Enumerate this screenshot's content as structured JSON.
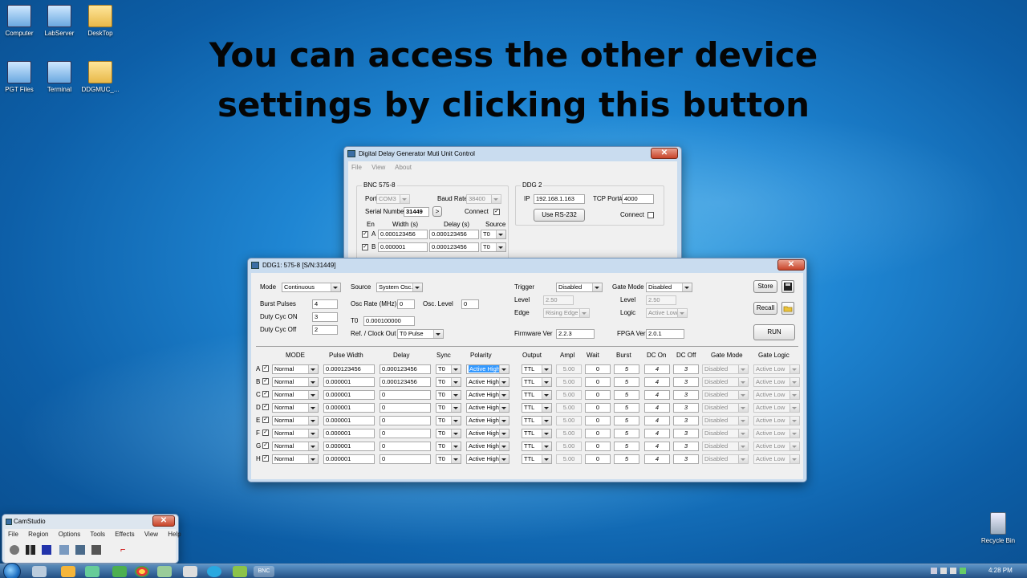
{
  "headline": {
    "line1": "You can access the other device",
    "line2": "settings by clicking this button"
  },
  "desktop_icons": [
    {
      "label": "Computer",
      "icon": "computer-icon"
    },
    {
      "label": "LabServer",
      "icon": "network-computer-icon"
    },
    {
      "label": "DeskTop",
      "icon": "folder-icon"
    },
    {
      "label": "PGT Files",
      "icon": "network-computer-icon"
    },
    {
      "label": "Terminal",
      "icon": "terminal-icon"
    },
    {
      "label": "DDGMUC_...",
      "icon": "folder-icon"
    },
    {
      "label": "Recycle Bin",
      "icon": "recycle-bin-icon"
    }
  ],
  "back_window": {
    "title": "Digital Delay Generator Muti Unit Control",
    "close": "✕",
    "menu": [
      "File",
      "View",
      "About"
    ],
    "group1": {
      "title": "BNC 575-8",
      "port_label": "Port",
      "port_value": "COM3",
      "baud_label": "Baud Rate",
      "baud_value": "38400",
      "serial_label": "Serial Number",
      "serial_value": "31449",
      "browse": ">",
      "connect_label": "Connect",
      "connect_check": "✓",
      "col_en": "En",
      "col_width": "Width (s)",
      "col_delay": "Delay (s)",
      "col_source": "Source",
      "rows": [
        {
          "ch": "A",
          "check": "✓",
          "width": "0.000123456",
          "delay": "0.000123456",
          "source": "T0"
        },
        {
          "ch": "B",
          "check": "✓",
          "width": "0.000001",
          "delay": "0.000123456",
          "source": "T0"
        }
      ]
    },
    "group2": {
      "title": "DDG 2",
      "ip_label": "IP",
      "ip_value": "192.168.1.163",
      "tcp_label": "TCP Port#",
      "tcp_value": "4000",
      "rs232_button": "Use RS-232",
      "connect_label": "Connect"
    }
  },
  "front_window": {
    "title": "DDG1: 575-8 [S/N:31449]",
    "close": "✕",
    "mode_label": "Mode",
    "mode_value": "Continuous",
    "source_label": "Source",
    "source_value": "System Osc.",
    "burst_label": "Burst Pulses",
    "burst_value": "4",
    "duty_on_label": "Duty Cyc ON",
    "duty_on_value": "3",
    "duty_off_label": "Duty Cyc Off",
    "duty_off_value": "2",
    "osc_rate_label": "Osc Rate (MHz)",
    "osc_rate_value": "0",
    "osc_level_label": "Osc. Level",
    "osc_level_value": "0",
    "t0_label": "T0",
    "t0_value": "0.000100000",
    "ref_label": "Ref. / Clock Out",
    "ref_value": "T0 Pulse",
    "trigger_label": "Trigger",
    "trigger_value": "Disabled",
    "trig_level_label": "Level",
    "trig_level_value": "2.50",
    "edge_label": "Edge",
    "edge_value": "Rising Edge",
    "gate_mode_label": "Gate Mode",
    "gate_mode_value": "Disabled",
    "gate_level_label": "Level",
    "gate_level_value": "2.50",
    "logic_label": "Logic",
    "logic_value": "Active Low",
    "firmware_label": "Firmware Ver",
    "firmware_value": "2.2.3",
    "fpga_label": "FPGA Ver",
    "fpga_value": "2.0.1",
    "store_button": "Store",
    "recall_button": "Recall",
    "run_button": "RUN",
    "table_headers": [
      "MODE",
      "Pulse Width",
      "Delay",
      "Sync",
      "Polarity",
      "Output",
      "Ampl",
      "Wait",
      "Burst",
      "DC On",
      "DC Off",
      "Gate Mode",
      "Gate Logic"
    ],
    "channels": [
      {
        "ch": "A",
        "check": "✓",
        "mode": "Normal",
        "width": "0.000123456",
        "delay": "0.000123456",
        "sync": "T0",
        "polarity": "Active High",
        "output": "TTL",
        "ampl": "5.00",
        "wait": "0",
        "burst": "5",
        "dc_on": "4",
        "dc_off": "3",
        "gate_mode": "Disabled",
        "gate_logic": "Active Low"
      },
      {
        "ch": "B",
        "check": "✓",
        "mode": "Normal",
        "width": "0.000001",
        "delay": "0.000123456",
        "sync": "T0",
        "polarity": "Active High",
        "output": "TTL",
        "ampl": "5.00",
        "wait": "0",
        "burst": "5",
        "dc_on": "4",
        "dc_off": "3",
        "gate_mode": "Disabled",
        "gate_logic": "Active Low"
      },
      {
        "ch": "C",
        "check": "✓",
        "mode": "Normal",
        "width": "0.000001",
        "delay": "0",
        "sync": "T0",
        "polarity": "Active High",
        "output": "TTL",
        "ampl": "5.00",
        "wait": "0",
        "burst": "5",
        "dc_on": "4",
        "dc_off": "3",
        "gate_mode": "Disabled",
        "gate_logic": "Active Low"
      },
      {
        "ch": "D",
        "check": "✓",
        "mode": "Normal",
        "width": "0.000001",
        "delay": "0",
        "sync": "T0",
        "polarity": "Active High",
        "output": "TTL",
        "ampl": "5.00",
        "wait": "0",
        "burst": "5",
        "dc_on": "4",
        "dc_off": "3",
        "gate_mode": "Disabled",
        "gate_logic": "Active Low"
      },
      {
        "ch": "E",
        "check": "✓",
        "mode": "Normal",
        "width": "0.000001",
        "delay": "0",
        "sync": "T0",
        "polarity": "Active High",
        "output": "TTL",
        "ampl": "5.00",
        "wait": "0",
        "burst": "5",
        "dc_on": "4",
        "dc_off": "3",
        "gate_mode": "Disabled",
        "gate_logic": "Active Low"
      },
      {
        "ch": "F",
        "check": "✓",
        "mode": "Normal",
        "width": "0.000001",
        "delay": "0",
        "sync": "T0",
        "polarity": "Active High",
        "output": "TTL",
        "ampl": "5.00",
        "wait": "0",
        "burst": "5",
        "dc_on": "4",
        "dc_off": "3",
        "gate_mode": "Disabled",
        "gate_logic": "Active Low"
      },
      {
        "ch": "G",
        "check": "✓",
        "mode": "Normal",
        "width": "0.000001",
        "delay": "0",
        "sync": "T0",
        "polarity": "Active High",
        "output": "TTL",
        "ampl": "5.00",
        "wait": "0",
        "burst": "5",
        "dc_on": "4",
        "dc_off": "3",
        "gate_mode": "Disabled",
        "gate_logic": "Active Low"
      },
      {
        "ch": "H",
        "check": "✓",
        "mode": "Normal",
        "width": "0.000001",
        "delay": "0",
        "sync": "T0",
        "polarity": "Active High",
        "output": "TTL",
        "ampl": "5.00",
        "wait": "0",
        "burst": "5",
        "dc_on": "4",
        "dc_off": "3",
        "gate_mode": "Disabled",
        "gate_logic": "Active Low"
      }
    ]
  },
  "camstudio": {
    "title": "CamStudio",
    "menu": [
      "File",
      "Region",
      "Options",
      "Tools",
      "Effects",
      "View",
      "Help"
    ]
  },
  "taskbar": {
    "clock": "4:28 PM",
    "active_app": "BNC"
  },
  "colors": {
    "accent": "#3399ff",
    "desktop": "#1f86d3"
  }
}
